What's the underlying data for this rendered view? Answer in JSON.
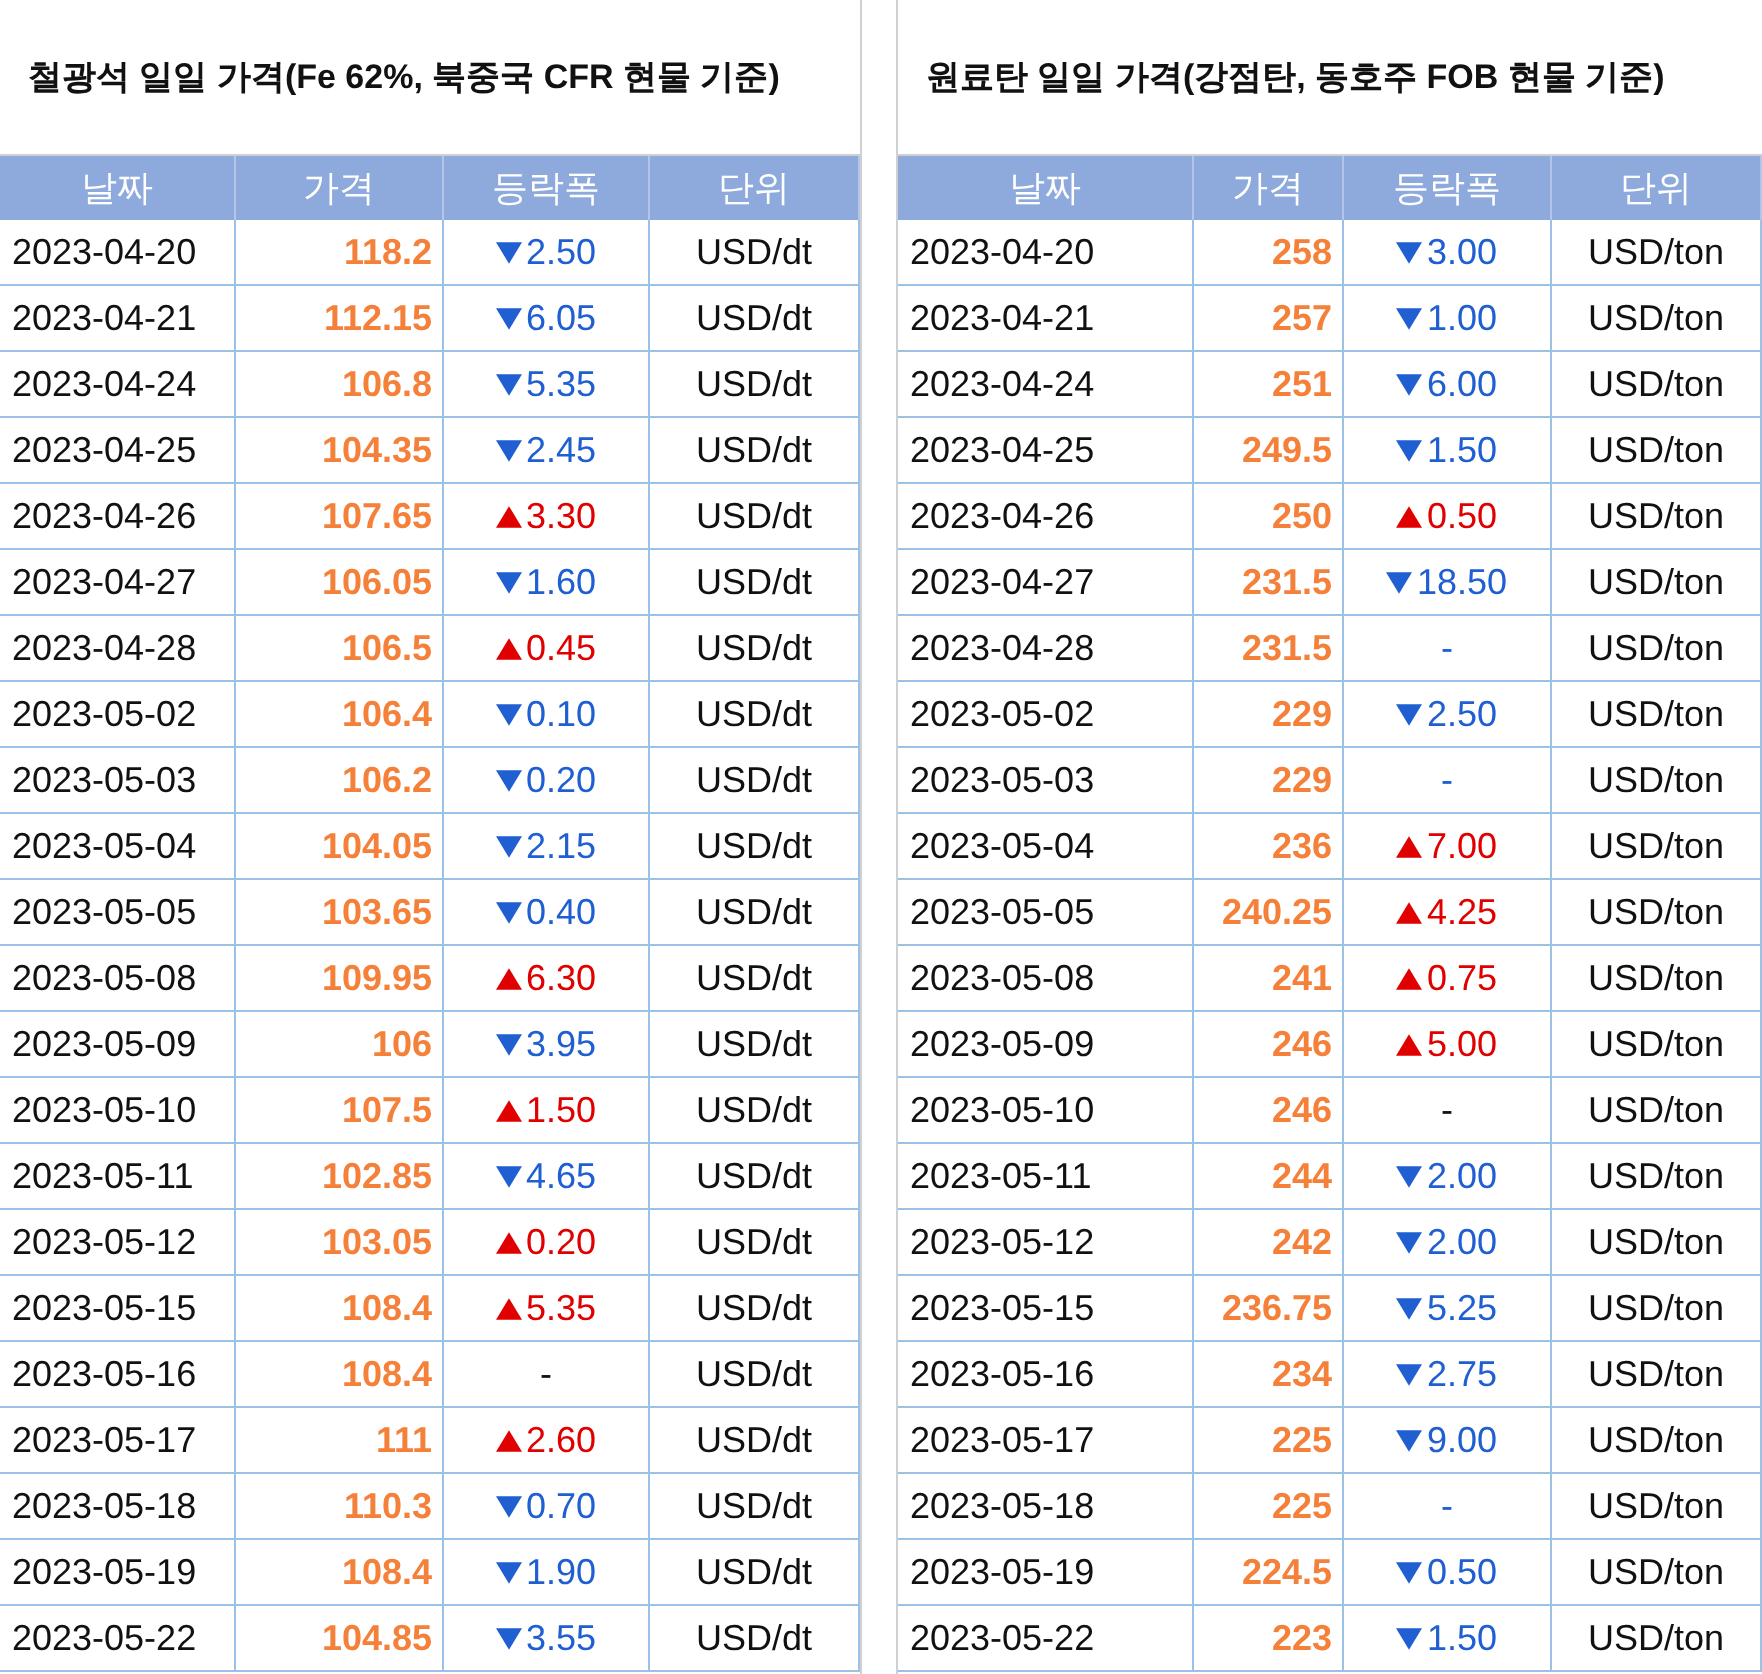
{
  "tables": [
    {
      "title": "철광석 일일 가격(Fe 62%, 북중국 CFR 현물 기준)",
      "columns": [
        "날짜",
        "가격",
        "등락폭",
        "단위"
      ],
      "rows": [
        {
          "date": "2023-04-20",
          "price": "118.2",
          "kind": "down",
          "change": "2.50",
          "unit": "USD/dt"
        },
        {
          "date": "2023-04-21",
          "price": "112.15",
          "kind": "down",
          "change": "6.05",
          "unit": "USD/dt"
        },
        {
          "date": "2023-04-24",
          "price": "106.8",
          "kind": "down",
          "change": "5.35",
          "unit": "USD/dt"
        },
        {
          "date": "2023-04-25",
          "price": "104.35",
          "kind": "down",
          "change": "2.45",
          "unit": "USD/dt"
        },
        {
          "date": "2023-04-26",
          "price": "107.65",
          "kind": "up",
          "change": "3.30",
          "unit": "USD/dt"
        },
        {
          "date": "2023-04-27",
          "price": "106.05",
          "kind": "down",
          "change": "1.60",
          "unit": "USD/dt"
        },
        {
          "date": "2023-04-28",
          "price": "106.5",
          "kind": "up",
          "change": "0.45",
          "unit": "USD/dt"
        },
        {
          "date": "2023-05-02",
          "price": "106.4",
          "kind": "down",
          "change": "0.10",
          "unit": "USD/dt"
        },
        {
          "date": "2023-05-03",
          "price": "106.2",
          "kind": "down",
          "change": "0.20",
          "unit": "USD/dt"
        },
        {
          "date": "2023-05-04",
          "price": "104.05",
          "kind": "down",
          "change": "2.15",
          "unit": "USD/dt"
        },
        {
          "date": "2023-05-05",
          "price": "103.65",
          "kind": "down",
          "change": "0.40",
          "unit": "USD/dt"
        },
        {
          "date": "2023-05-08",
          "price": "109.95",
          "kind": "up",
          "change": "6.30",
          "unit": "USD/dt"
        },
        {
          "date": "2023-05-09",
          "price": "106",
          "kind": "down",
          "change": "3.95",
          "unit": "USD/dt"
        },
        {
          "date": "2023-05-10",
          "price": "107.5",
          "kind": "up",
          "change": "1.50",
          "unit": "USD/dt"
        },
        {
          "date": "2023-05-11",
          "price": "102.85",
          "kind": "down",
          "change": "4.65",
          "unit": "USD/dt"
        },
        {
          "date": "2023-05-12",
          "price": "103.05",
          "kind": "up",
          "change": "0.20",
          "unit": "USD/dt"
        },
        {
          "date": "2023-05-15",
          "price": "108.4",
          "kind": "up",
          "change": "5.35",
          "unit": "USD/dt"
        },
        {
          "date": "2023-05-16",
          "price": "108.4",
          "kind": "none",
          "change": "-",
          "unit": "USD/dt"
        },
        {
          "date": "2023-05-17",
          "price": "111",
          "kind": "up",
          "change": "2.60",
          "unit": "USD/dt"
        },
        {
          "date": "2023-05-18",
          "price": "110.3",
          "kind": "down",
          "change": "0.70",
          "unit": "USD/dt"
        },
        {
          "date": "2023-05-19",
          "price": "108.4",
          "kind": "down",
          "change": "1.90",
          "unit": "USD/dt"
        },
        {
          "date": "2023-05-22",
          "price": "104.85",
          "kind": "down",
          "change": "3.55",
          "unit": "USD/dt"
        }
      ]
    },
    {
      "title": "원료탄 일일 가격(강점탄, 동호주 FOB 현물 기준)",
      "columns": [
        "날짜",
        "가격",
        "등락폭",
        "단위"
      ],
      "rows": [
        {
          "date": "2023-04-20",
          "price": "258",
          "kind": "down",
          "change": "3.00",
          "unit": "USD/ton"
        },
        {
          "date": "2023-04-21",
          "price": "257",
          "kind": "down",
          "change": "1.00",
          "unit": "USD/ton"
        },
        {
          "date": "2023-04-24",
          "price": "251",
          "kind": "down",
          "change": "6.00",
          "unit": "USD/ton"
        },
        {
          "date": "2023-04-25",
          "price": "249.5",
          "kind": "down",
          "change": "1.50",
          "unit": "USD/ton"
        },
        {
          "date": "2023-04-26",
          "price": "250",
          "kind": "up",
          "change": "0.50",
          "unit": "USD/ton"
        },
        {
          "date": "2023-04-27",
          "price": "231.5",
          "kind": "down",
          "change": "18.50",
          "unit": "USD/ton"
        },
        {
          "date": "2023-04-28",
          "price": "231.5",
          "kind": "flat",
          "change": "-",
          "unit": "USD/ton"
        },
        {
          "date": "2023-05-02",
          "price": "229",
          "kind": "down",
          "change": "2.50",
          "unit": "USD/ton"
        },
        {
          "date": "2023-05-03",
          "price": "229",
          "kind": "flat",
          "change": "-",
          "unit": "USD/ton"
        },
        {
          "date": "2023-05-04",
          "price": "236",
          "kind": "up",
          "change": "7.00",
          "unit": "USD/ton"
        },
        {
          "date": "2023-05-05",
          "price": "240.25",
          "kind": "up",
          "change": "4.25",
          "unit": "USD/ton"
        },
        {
          "date": "2023-05-08",
          "price": "241",
          "kind": "up",
          "change": "0.75",
          "unit": "USD/ton"
        },
        {
          "date": "2023-05-09",
          "price": "246",
          "kind": "up",
          "change": "5.00",
          "unit": "USD/ton"
        },
        {
          "date": "2023-05-10",
          "price": "246",
          "kind": "none",
          "change": "-",
          "unit": "USD/ton"
        },
        {
          "date": "2023-05-11",
          "price": "244",
          "kind": "down",
          "change": "2.00",
          "unit": "USD/ton"
        },
        {
          "date": "2023-05-12",
          "price": "242",
          "kind": "down",
          "change": "2.00",
          "unit": "USD/ton"
        },
        {
          "date": "2023-05-15",
          "price": "236.75",
          "kind": "down",
          "change": "5.25",
          "unit": "USD/ton"
        },
        {
          "date": "2023-05-16",
          "price": "234",
          "kind": "down",
          "change": "2.75",
          "unit": "USD/ton"
        },
        {
          "date": "2023-05-17",
          "price": "225",
          "kind": "down",
          "change": "9.00",
          "unit": "USD/ton"
        },
        {
          "date": "2023-05-18",
          "price": "225",
          "kind": "flat",
          "change": "-",
          "unit": "USD/ton"
        },
        {
          "date": "2023-05-19",
          "price": "224.5",
          "kind": "down",
          "change": "0.50",
          "unit": "USD/ton"
        },
        {
          "date": "2023-05-22",
          "price": "223",
          "kind": "down",
          "change": "1.50",
          "unit": "USD/ton"
        }
      ]
    }
  ]
}
